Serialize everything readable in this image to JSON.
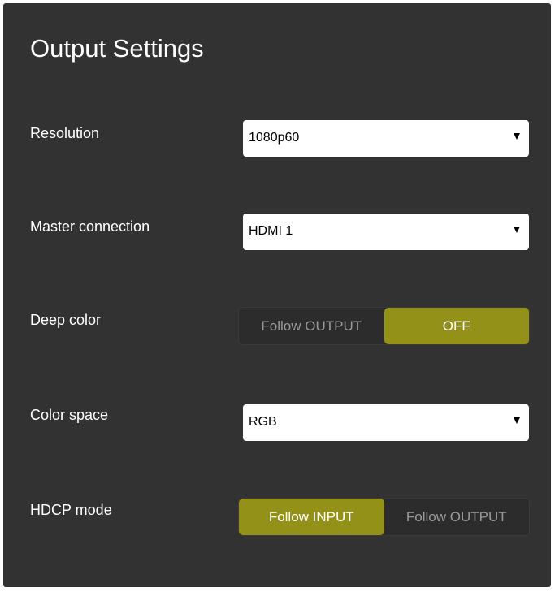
{
  "title": "Output Settings",
  "resolution": {
    "label": "Resolution",
    "value": "1080p60"
  },
  "master_connection": {
    "label": "Master connection",
    "value": "HDMI 1"
  },
  "deep_color": {
    "label": "Deep color",
    "options": [
      "Follow OUTPUT",
      "OFF"
    ],
    "selected": "OFF"
  },
  "color_space": {
    "label": "Color space",
    "value": "RGB"
  },
  "hdcp_mode": {
    "label": "HDCP mode",
    "options": [
      "Follow INPUT",
      "Follow OUTPUT"
    ],
    "selected": "Follow INPUT"
  },
  "colors": {
    "panel": "#323232",
    "accent": "#949119",
    "text": "#ffffff",
    "muted": "#9a9a9a"
  }
}
